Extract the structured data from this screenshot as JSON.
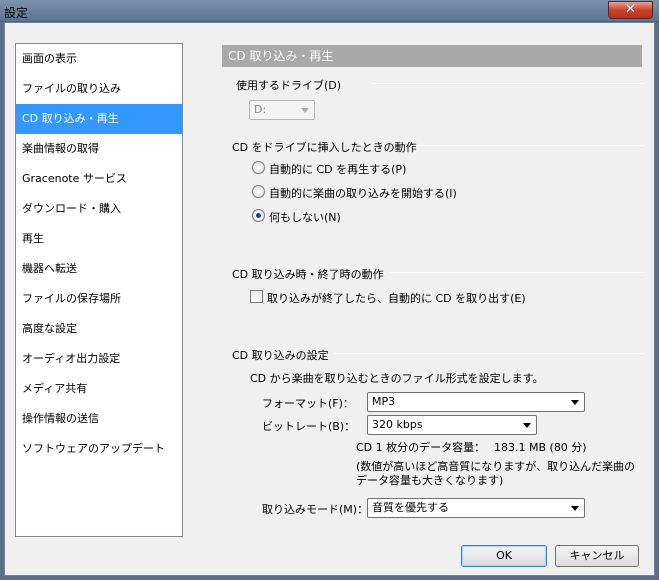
{
  "window": {
    "title": "設定",
    "close_glyph": "✕"
  },
  "sidebar": {
    "items": [
      {
        "label": "画面の表示"
      },
      {
        "label": "ファイルの取り込み"
      },
      {
        "label": "CD 取り込み・再生"
      },
      {
        "label": "楽曲情報の取得"
      },
      {
        "label": "Gracenote サービス"
      },
      {
        "label": "ダウンロード・購入"
      },
      {
        "label": "再生"
      },
      {
        "label": "機器へ転送"
      },
      {
        "label": "ファイルの保存場所"
      },
      {
        "label": "高度な設定"
      },
      {
        "label": "オーディオ出力設定"
      },
      {
        "label": "メディア共有"
      },
      {
        "label": "操作情報の送信"
      },
      {
        "label": "ソフトウェアのアップデート"
      }
    ],
    "selected_index": 2
  },
  "content": {
    "header": "CD 取り込み・再生",
    "drive": {
      "title": "使用するドライブ(D)",
      "value": "D:"
    },
    "insert_action": {
      "title": "CD をドライブに挿入したときの動作",
      "options": [
        {
          "label": "自動的に CD を再生する(P)",
          "checked": false
        },
        {
          "label": "自動的に楽曲の取り込みを開始する(I)",
          "checked": false
        },
        {
          "label": "何もしない(N)",
          "checked": true
        }
      ]
    },
    "rip_end": {
      "title": "CD 取り込み時・終了時の動作",
      "eject_label": "取り込みが終了したら、自動的に CD を取り出す(E)",
      "eject_checked": false
    },
    "rip_settings": {
      "title": "CD 取り込みの設定",
      "description": "CD から楽曲を取り込むときのファイル形式を設定します。",
      "format_label": "フォーマット(F)：",
      "format_value": "MP3",
      "bitrate_label": "ビットレート(B)：",
      "bitrate_value": "320 kbps",
      "capacity_label": "CD 1 枚分のデータ容量：",
      "capacity_value": "183.1 MB (80 分)",
      "note_line1": "(数値が高いほど高音質になりますが、取り込んだ楽曲の",
      "note_line2": "データ容量も大きくなります)",
      "mode_label": "取り込みモード(M)：",
      "mode_value": "音質を優先する"
    }
  },
  "buttons": {
    "ok": "OK",
    "cancel": "キャンセル"
  }
}
